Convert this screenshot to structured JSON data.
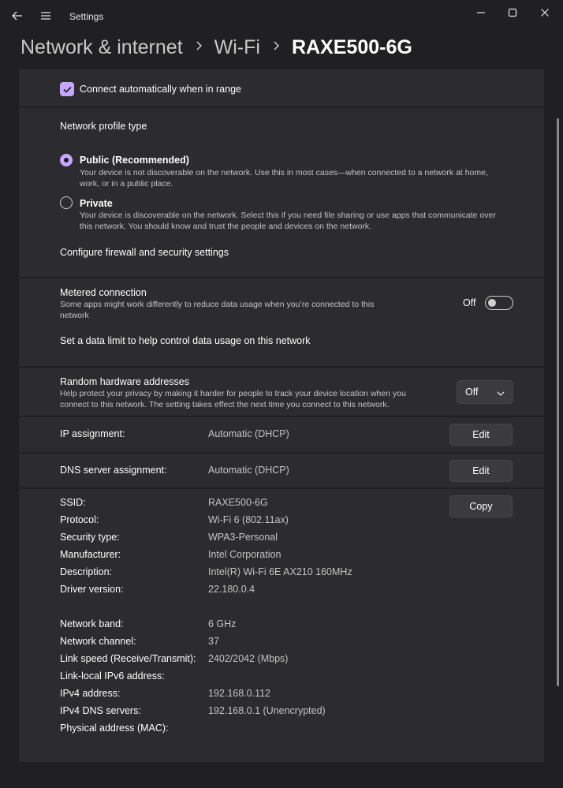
{
  "window": {
    "app_title": "Settings"
  },
  "breadcrumb": {
    "level1": "Network & internet",
    "level2": "Wi-Fi",
    "current": "RAXE500-6G"
  },
  "connect_auto": {
    "label": "Connect automatically when in range",
    "checked": true
  },
  "profile": {
    "heading": "Network profile type",
    "public_title": "Public (Recommended)",
    "public_desc_line1": "Your device is not discoverable on the network. Use this in most cases—when connected to a network at home,",
    "public_desc_line2": "work, or in a public place.",
    "private_title": "Private",
    "private_desc_line1": "Your device is discoverable on the network. Select this if you need file sharing or use apps that communicate over",
    "private_desc_line2": "this network. You should know and trust the people and devices on the network.",
    "selected": "Public (Recommended)",
    "firewall_link": "Configure firewall and security settings"
  },
  "metered": {
    "title": "Metered connection",
    "desc_line1": "Some apps might work differently to reduce data usage when you’re connected to this",
    "desc_line2": "network",
    "state_label": "Off",
    "data_limit_link": "Set a data limit to help control data usage on this network"
  },
  "random_hw": {
    "title": "Random hardware addresses",
    "desc_line1": "Help protect your privacy by making it harder for people to track your device location when you",
    "desc_line2": "connect to this network. The setting takes effect the next time you connect to this network.",
    "value": "Off"
  },
  "ip_assignment": {
    "label": "IP assignment:",
    "value": "Automatic (DHCP)",
    "button": "Edit"
  },
  "dns_assignment": {
    "label": "DNS server assignment:",
    "value": "Automatic (DHCP)",
    "button": "Edit"
  },
  "properties": {
    "copy_button": "Copy",
    "rows": [
      {
        "label": "SSID:",
        "value": "RAXE500-6G"
      },
      {
        "label": "Protocol:",
        "value": "Wi-Fi 6 (802.11ax)"
      },
      {
        "label": "Security type:",
        "value": "WPA3-Personal"
      },
      {
        "label": "Manufacturer:",
        "value": "Intel Corporation"
      },
      {
        "label": "Description:",
        "value": "Intel(R) Wi-Fi 6E AX210 160MHz"
      },
      {
        "label": "Driver version:",
        "value": "22.180.0.4"
      },
      {
        "label": "Network band:",
        "value": "6 GHz"
      },
      {
        "label": "Network channel:",
        "value": "37"
      },
      {
        "label": "Link speed (Receive/Transmit):",
        "value": "2402/2042 (Mbps)"
      },
      {
        "label": "Link-local IPv6 address:",
        "value": ""
      },
      {
        "label": "IPv4 address:",
        "value": "192.168.0.112"
      },
      {
        "label": "IPv4 DNS servers:",
        "value": "192.168.0.1 (Unencrypted)"
      },
      {
        "label": "Physical address (MAC):",
        "value": ""
      }
    ]
  },
  "colors": {
    "accent": "#c6a7ff",
    "background": "#202020",
    "card": "#2b2b30"
  },
  "icons": [
    "back-arrow-icon",
    "hamburger-menu-icon",
    "minimize-icon",
    "maximize-icon",
    "close-icon",
    "chevron-right-icon",
    "checkmark-icon",
    "chevron-down-icon"
  ]
}
